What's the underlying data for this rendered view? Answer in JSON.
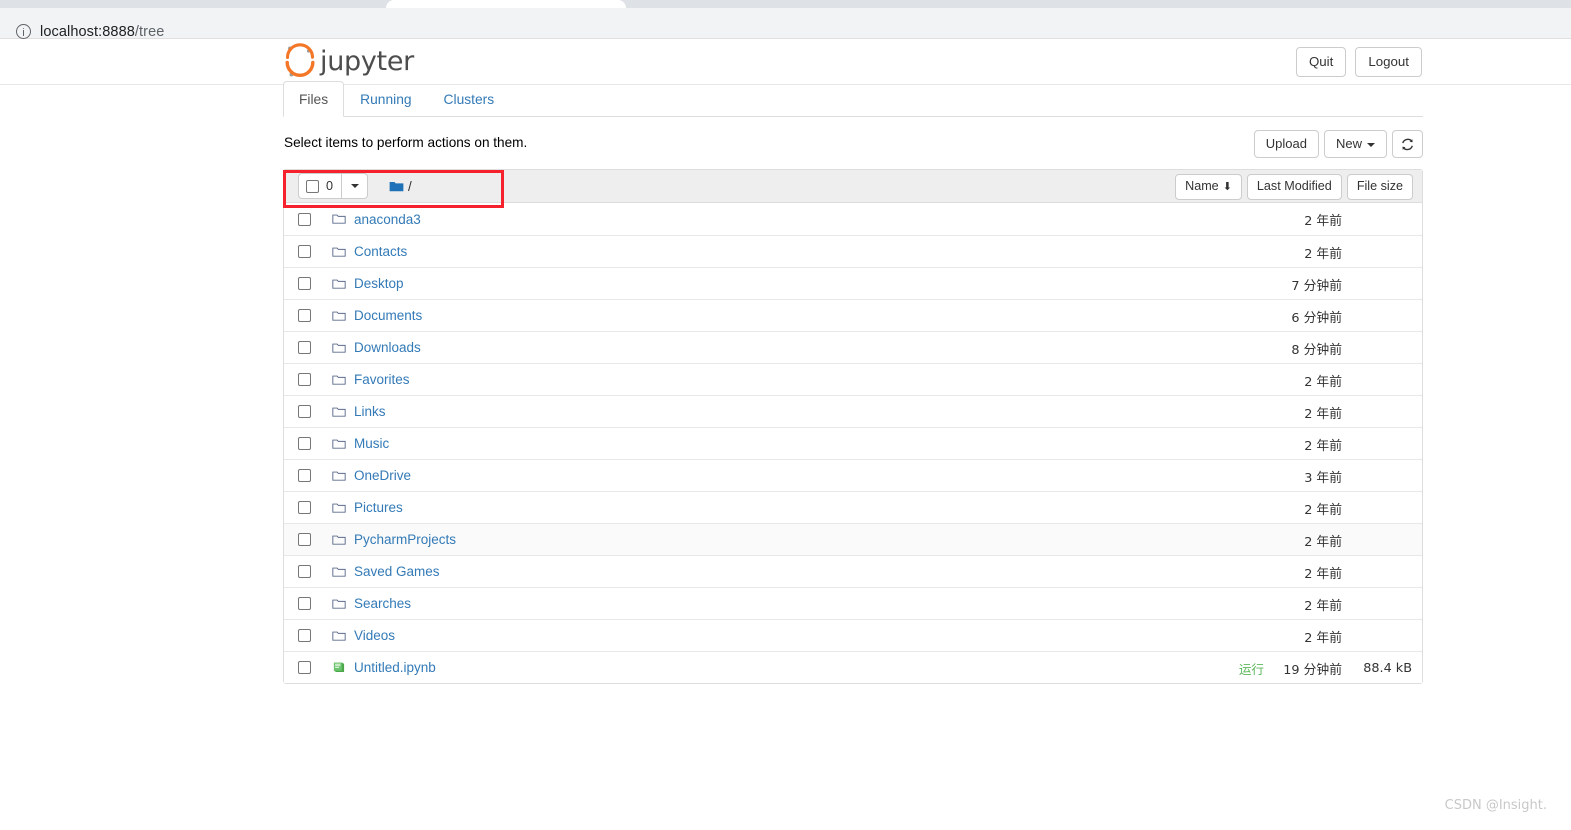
{
  "browser": {
    "url_host": "localhost:8888",
    "url_path": "/tree",
    "info_icon": "info-circle-icon"
  },
  "header": {
    "logo_text": "jupyter",
    "quit_label": "Quit",
    "logout_label": "Logout"
  },
  "tabs": [
    {
      "label": "Files",
      "active": true
    },
    {
      "label": "Running",
      "active": false
    },
    {
      "label": "Clusters",
      "active": false
    }
  ],
  "toolbar": {
    "select_hint": "Select items to perform actions on them.",
    "upload_label": "Upload",
    "new_label": "New",
    "refresh_icon": "refresh-icon"
  },
  "list_header": {
    "selected_count": "0",
    "breadcrumb_root": "/",
    "folder_icon": "folder-filled-icon",
    "sort_name": "Name",
    "sort_name_arrow": "⬇",
    "sort_last_modified": "Last Modified",
    "sort_file_size": "File size"
  },
  "files": [
    {
      "name": "anaconda3",
      "type": "folder",
      "modified": "2 年前",
      "size": "",
      "status": "",
      "alt": false
    },
    {
      "name": "Contacts",
      "type": "folder",
      "modified": "2 年前",
      "size": "",
      "status": "",
      "alt": false
    },
    {
      "name": "Desktop",
      "type": "folder",
      "modified": "7 分钟前",
      "size": "",
      "status": "",
      "alt": false
    },
    {
      "name": "Documents",
      "type": "folder",
      "modified": "6 分钟前",
      "size": "",
      "status": "",
      "alt": false
    },
    {
      "name": "Downloads",
      "type": "folder",
      "modified": "8 分钟前",
      "size": "",
      "status": "",
      "alt": false
    },
    {
      "name": "Favorites",
      "type": "folder",
      "modified": "2 年前",
      "size": "",
      "status": "",
      "alt": false
    },
    {
      "name": "Links",
      "type": "folder",
      "modified": "2 年前",
      "size": "",
      "status": "",
      "alt": false
    },
    {
      "name": "Music",
      "type": "folder",
      "modified": "2 年前",
      "size": "",
      "status": "",
      "alt": false
    },
    {
      "name": "OneDrive",
      "type": "folder",
      "modified": "3 年前",
      "size": "",
      "status": "",
      "alt": false
    },
    {
      "name": "Pictures",
      "type": "folder",
      "modified": "2 年前",
      "size": "",
      "status": "",
      "alt": false
    },
    {
      "name": "PycharmProjects",
      "type": "folder",
      "modified": "2 年前",
      "size": "",
      "status": "",
      "alt": true
    },
    {
      "name": "Saved Games",
      "type": "folder",
      "modified": "2 年前",
      "size": "",
      "status": "",
      "alt": false
    },
    {
      "name": "Searches",
      "type": "folder",
      "modified": "2 年前",
      "size": "",
      "status": "",
      "alt": false
    },
    {
      "name": "Videos",
      "type": "folder",
      "modified": "2 年前",
      "size": "",
      "status": "",
      "alt": false
    },
    {
      "name": "Untitled.ipynb",
      "type": "notebook",
      "modified": "19 分钟前",
      "size": "88.4 kB",
      "status": "运行",
      "alt": false
    }
  ],
  "annotation": {
    "color": "#f5222d"
  },
  "watermark": "CSDN @Insight."
}
